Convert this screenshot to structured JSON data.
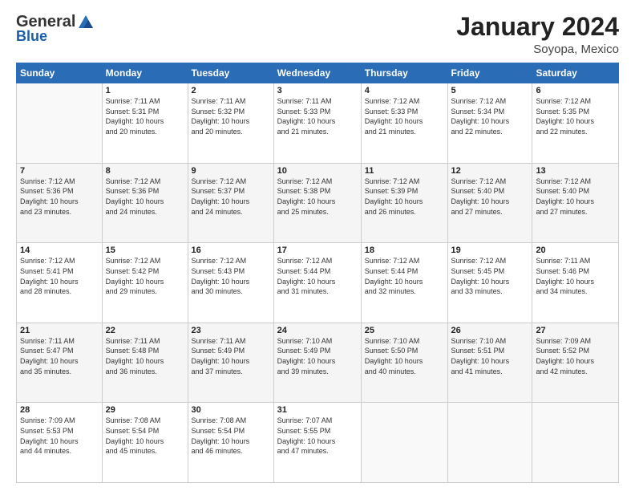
{
  "logo": {
    "general": "General",
    "blue": "Blue"
  },
  "header": {
    "title": "January 2024",
    "subtitle": "Soyopa, Mexico"
  },
  "weekdays": [
    "Sunday",
    "Monday",
    "Tuesday",
    "Wednesday",
    "Thursday",
    "Friday",
    "Saturday"
  ],
  "weeks": [
    [
      {
        "day": "",
        "sunrise": "",
        "sunset": "",
        "daylight": ""
      },
      {
        "day": "1",
        "sunrise": "7:11 AM",
        "sunset": "5:31 PM",
        "daylight": "10 hours and 20 minutes."
      },
      {
        "day": "2",
        "sunrise": "7:11 AM",
        "sunset": "5:32 PM",
        "daylight": "10 hours and 20 minutes."
      },
      {
        "day": "3",
        "sunrise": "7:11 AM",
        "sunset": "5:33 PM",
        "daylight": "10 hours and 21 minutes."
      },
      {
        "day": "4",
        "sunrise": "7:12 AM",
        "sunset": "5:33 PM",
        "daylight": "10 hours and 21 minutes."
      },
      {
        "day": "5",
        "sunrise": "7:12 AM",
        "sunset": "5:34 PM",
        "daylight": "10 hours and 22 minutes."
      },
      {
        "day": "6",
        "sunrise": "7:12 AM",
        "sunset": "5:35 PM",
        "daylight": "10 hours and 22 minutes."
      }
    ],
    [
      {
        "day": "7",
        "sunrise": "7:12 AM",
        "sunset": "5:36 PM",
        "daylight": "10 hours and 23 minutes."
      },
      {
        "day": "8",
        "sunrise": "7:12 AM",
        "sunset": "5:36 PM",
        "daylight": "10 hours and 24 minutes."
      },
      {
        "day": "9",
        "sunrise": "7:12 AM",
        "sunset": "5:37 PM",
        "daylight": "10 hours and 24 minutes."
      },
      {
        "day": "10",
        "sunrise": "7:12 AM",
        "sunset": "5:38 PM",
        "daylight": "10 hours and 25 minutes."
      },
      {
        "day": "11",
        "sunrise": "7:12 AM",
        "sunset": "5:39 PM",
        "daylight": "10 hours and 26 minutes."
      },
      {
        "day": "12",
        "sunrise": "7:12 AM",
        "sunset": "5:40 PM",
        "daylight": "10 hours and 27 minutes."
      },
      {
        "day": "13",
        "sunrise": "7:12 AM",
        "sunset": "5:40 PM",
        "daylight": "10 hours and 27 minutes."
      }
    ],
    [
      {
        "day": "14",
        "sunrise": "7:12 AM",
        "sunset": "5:41 PM",
        "daylight": "10 hours and 28 minutes."
      },
      {
        "day": "15",
        "sunrise": "7:12 AM",
        "sunset": "5:42 PM",
        "daylight": "10 hours and 29 minutes."
      },
      {
        "day": "16",
        "sunrise": "7:12 AM",
        "sunset": "5:43 PM",
        "daylight": "10 hours and 30 minutes."
      },
      {
        "day": "17",
        "sunrise": "7:12 AM",
        "sunset": "5:44 PM",
        "daylight": "10 hours and 31 minutes."
      },
      {
        "day": "18",
        "sunrise": "7:12 AM",
        "sunset": "5:44 PM",
        "daylight": "10 hours and 32 minutes."
      },
      {
        "day": "19",
        "sunrise": "7:12 AM",
        "sunset": "5:45 PM",
        "daylight": "10 hours and 33 minutes."
      },
      {
        "day": "20",
        "sunrise": "7:11 AM",
        "sunset": "5:46 PM",
        "daylight": "10 hours and 34 minutes."
      }
    ],
    [
      {
        "day": "21",
        "sunrise": "7:11 AM",
        "sunset": "5:47 PM",
        "daylight": "10 hours and 35 minutes."
      },
      {
        "day": "22",
        "sunrise": "7:11 AM",
        "sunset": "5:48 PM",
        "daylight": "10 hours and 36 minutes."
      },
      {
        "day": "23",
        "sunrise": "7:11 AM",
        "sunset": "5:49 PM",
        "daylight": "10 hours and 37 minutes."
      },
      {
        "day": "24",
        "sunrise": "7:10 AM",
        "sunset": "5:49 PM",
        "daylight": "10 hours and 39 minutes."
      },
      {
        "day": "25",
        "sunrise": "7:10 AM",
        "sunset": "5:50 PM",
        "daylight": "10 hours and 40 minutes."
      },
      {
        "day": "26",
        "sunrise": "7:10 AM",
        "sunset": "5:51 PM",
        "daylight": "10 hours and 41 minutes."
      },
      {
        "day": "27",
        "sunrise": "7:09 AM",
        "sunset": "5:52 PM",
        "daylight": "10 hours and 42 minutes."
      }
    ],
    [
      {
        "day": "28",
        "sunrise": "7:09 AM",
        "sunset": "5:53 PM",
        "daylight": "10 hours and 44 minutes."
      },
      {
        "day": "29",
        "sunrise": "7:08 AM",
        "sunset": "5:54 PM",
        "daylight": "10 hours and 45 minutes."
      },
      {
        "day": "30",
        "sunrise": "7:08 AM",
        "sunset": "5:54 PM",
        "daylight": "10 hours and 46 minutes."
      },
      {
        "day": "31",
        "sunrise": "7:07 AM",
        "sunset": "5:55 PM",
        "daylight": "10 hours and 47 minutes."
      },
      {
        "day": "",
        "sunrise": "",
        "sunset": "",
        "daylight": ""
      },
      {
        "day": "",
        "sunrise": "",
        "sunset": "",
        "daylight": ""
      },
      {
        "day": "",
        "sunrise": "",
        "sunset": "",
        "daylight": ""
      }
    ]
  ],
  "labels": {
    "sunrise": "Sunrise:",
    "sunset": "Sunset:",
    "daylight": "Daylight:"
  }
}
